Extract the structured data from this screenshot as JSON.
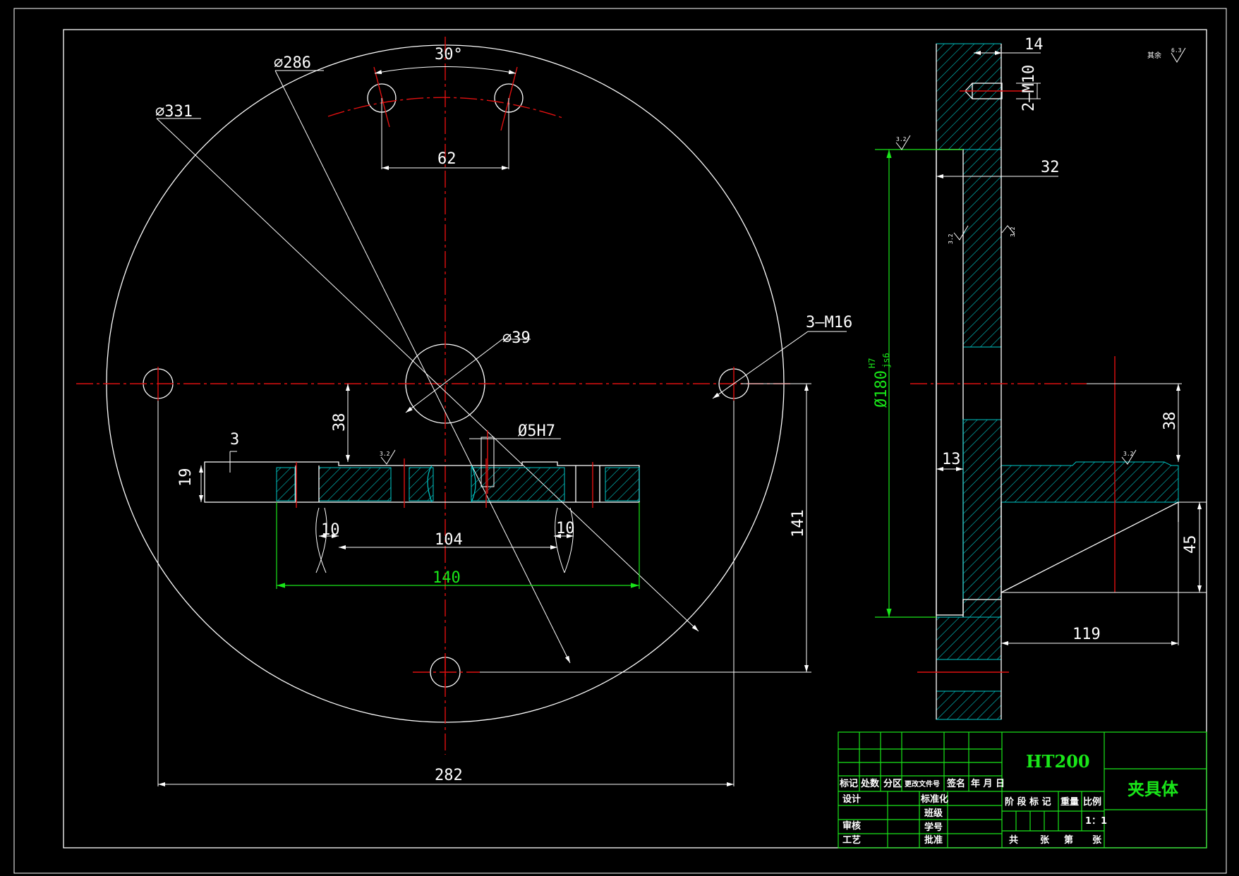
{
  "dimensions": {
    "d286": "⌀286",
    "d331": "⌀331",
    "ang30": "30°",
    "w62": "62",
    "d39": "⌀39",
    "m16": "3—M16",
    "d5h7": "Ø5H7",
    "h3": "3",
    "h19": "19",
    "h38a": "38",
    "w10a": "10",
    "w10b": "10",
    "w104": "104",
    "w140": "140",
    "h141": "141",
    "w282": "282",
    "w14": "14",
    "m10": "2—M10",
    "w32": "32",
    "d180": "Ø180",
    "d180fit_up": "H7",
    "d180fit_lo": "js6",
    "w13": "13",
    "h38b": "38",
    "h45": "45",
    "w119": "119"
  },
  "roughness": {
    "corner_label": "其余",
    "corner_value": "6.3",
    "r1": "3.2",
    "r2": "3.2",
    "r3": "3.2",
    "r4": "3.2",
    "r5": "3.2"
  },
  "title_block": {
    "material": "HT200",
    "part_name": "夹具体",
    "rev_cols": [
      "标记",
      "处数",
      "分区",
      "更改文件号",
      "签名",
      "年 月 日"
    ],
    "rows_left": [
      "设计",
      "审核",
      "工艺"
    ],
    "rows_mid": [
      "标准化",
      "班级",
      "学号",
      "批准"
    ],
    "stage_cols": [
      "阶 段 标 记",
      "重量",
      "比例"
    ],
    "scale": "1：1",
    "sheet": [
      "共",
      "张",
      "第",
      "张"
    ]
  },
  "colors": {
    "background": "#000000",
    "outline": "#ffffff",
    "centerline": "#e01010",
    "dimension_green": "#19e619",
    "hatch": "#00c8c8"
  }
}
